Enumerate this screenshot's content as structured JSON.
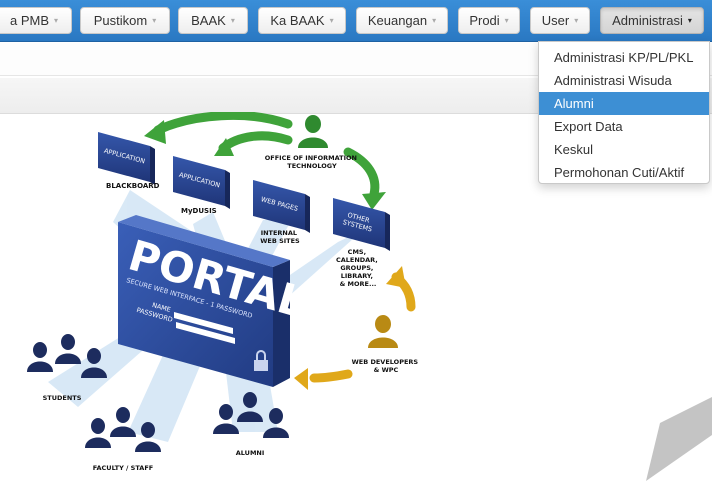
{
  "navbar": {
    "items": [
      {
        "label": "a PMB",
        "caret": "▾"
      },
      {
        "label": "Pustikom",
        "caret": "▾"
      },
      {
        "label": "BAAK",
        "caret": "▾"
      },
      {
        "label": "Ka BAAK",
        "caret": "▾"
      },
      {
        "label": "Keuangan",
        "caret": "▾"
      },
      {
        "label": "Prodi",
        "caret": "▾"
      },
      {
        "label": "User",
        "caret": "▾"
      },
      {
        "label": "Administrasi",
        "caret": "▾"
      }
    ]
  },
  "dropdown": {
    "items": [
      {
        "label": "Administrasi KP/PL/PKL"
      },
      {
        "label": "Administrasi Wisuda"
      },
      {
        "label": "Alumni"
      },
      {
        "label": "Export Data"
      },
      {
        "label": "Keskul"
      },
      {
        "label": "Permohonan Cuti/Aktif"
      }
    ],
    "highlighted_index": 2
  },
  "illustration": {
    "portal_title": "PORTAL",
    "portal_subtitle": "SECURE WEB INTERFACE - 1 PASSWORD",
    "name_label": "NAME",
    "password_label": "PASSWORD",
    "apps": [
      {
        "box": "APPLICATION",
        "caption": "BLACKBOARD"
      },
      {
        "box": "APPLICATION",
        "caption": "MyDUSIS"
      },
      {
        "box": "WEB PAGES",
        "caption_lines": [
          "INTERNAL",
          "WEB SITES"
        ]
      },
      {
        "box_lines": [
          "OTHER",
          "SYSTEMS"
        ],
        "caption_lines": [
          "CMS,",
          "CALENDAR,",
          "GROUPS,",
          "LIBRARY,",
          "& MORE..."
        ]
      }
    ],
    "oit_lines": [
      "OFFICE OF INFORMATION",
      "TECHNOLOGY"
    ],
    "webdev_lines": [
      "WEB DEVELOPERS",
      "& WPC"
    ],
    "students": "STUDENTS",
    "faculty": "FACULTY / STAFF",
    "alumni": "ALUMNI"
  },
  "colors": {
    "navbar": "#2f80cc",
    "highlight": "#3d8fd4",
    "portal_blue": "#2c4a9c",
    "arrow_green": "#3fa33a",
    "arrow_gold": "#e0a81a",
    "figure_navy": "#1d2c5e",
    "figure_green": "#2f8a2f",
    "figure_gold": "#b98a14"
  }
}
